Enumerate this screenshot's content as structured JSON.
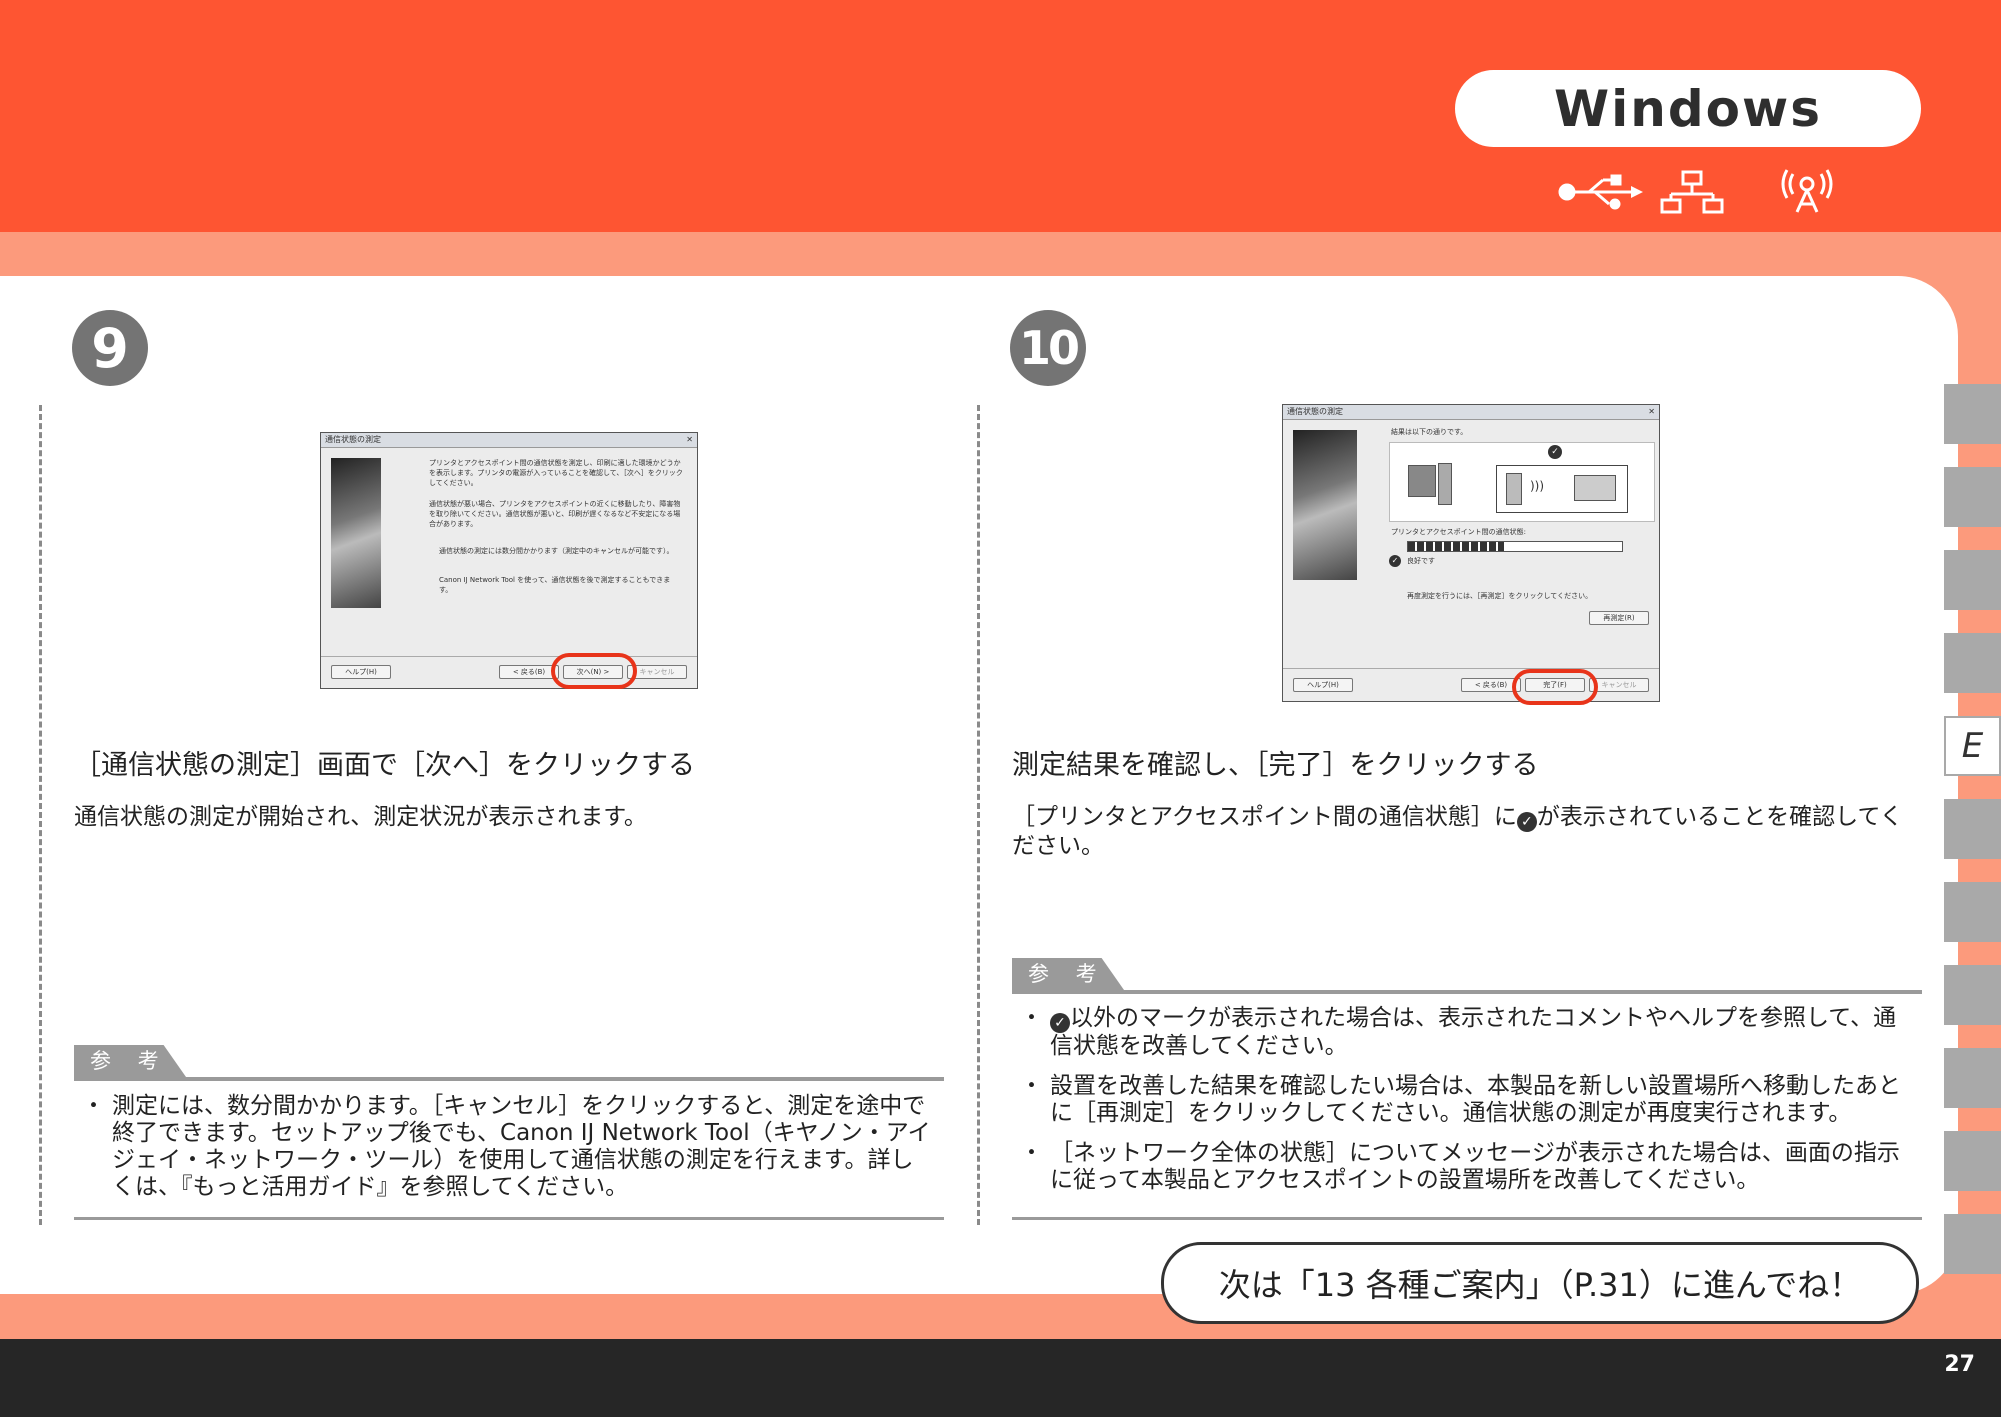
{
  "header": {
    "os_label": "Windows",
    "connection_icons": [
      "usb-icon",
      "wired-lan-icon",
      "wireless-lan-icon"
    ]
  },
  "side_tab": {
    "label": "E"
  },
  "step9": {
    "number": "9",
    "heading": "［通信状態の測定］画面で［次へ］をクリックする",
    "body": "通信状態の測定が開始され、測定状況が表示されます。",
    "note_label": "参 考",
    "notes": [
      "測定には、数分間かかります。［キャンセル］をクリックすると、測定を途中で終了できます。セットアップ後でも、Canon IJ Network Tool（キヤノン・アイジェイ・ネットワーク・ツール）を使用して通信状態の測定を行えます。詳しくは、『もっと活用ガイド』を参照してください。"
    ],
    "screenshot": {
      "title": "通信状態の測定",
      "text1": "プリンタとアクセスポイント間の通信状態を測定し、印刷に適した環境かどうかを表示します。プリンタの電源が入っていることを確認して、［次へ］をクリックしてください。",
      "text2": "通信状態が悪い場合、プリンタをアクセスポイントの近くに移動したり、障害物を取り除いてください。通信状態が悪いと、印刷が遅くなるなど不安定になる場合があります。",
      "bullet1": "通信状態の測定には数分間かかります（測定中のキャンセルが可能です）。",
      "bullet2": "Canon IJ Network Tool を使って、通信状態を後で測定することもできます。",
      "help_button": "ヘルプ(H)",
      "back_button": "< 戻る(B)",
      "next_button": "次へ(N) >",
      "cancel_button": "キャンセル"
    }
  },
  "step10": {
    "number": "10",
    "heading": "測定結果を確認し、［完了］をクリックする",
    "body_before_check": "［プリンタとアクセスポイント間の通信状態］に",
    "body_after_check": "が表示されていることを確認してください。",
    "note_label": "参 考",
    "notes": [
      {
        "before": "",
        "check": true,
        "after": "以外のマークが表示された場合は、表示されたコメントやヘルプを参照して、通信状態を改善してください。"
      },
      {
        "before": "設置を改善した結果を確認したい場合は、本製品を新しい設置場所へ移動したあとに［再測定］をクリックしてください。通信状態の測定が再度実行されます。",
        "check": false,
        "after": ""
      },
      {
        "before": "［ネットワーク全体の状態］についてメッセージが表示された場合は、画面の指示に従って本製品とアクセスポイントの設置場所を改善してください。",
        "check": false,
        "after": ""
      }
    ],
    "screenshot": {
      "title": "通信状態の測定",
      "result_text": "結果は以下の通りです。",
      "status_label": "プリンタとアクセスポイント間の通信状態:",
      "status_value": "良好です",
      "remeasure_text": "再度測定を行うには、［再測定］をクリックしてください。",
      "remeasure_button": "再測定(R)",
      "help_button": "ヘルプ(H)",
      "back_button": "< 戻る(B)",
      "finish_button": "完了(F)",
      "cancel_button": "キャンセル",
      "signal_level": 0.45
    }
  },
  "next_message": "次は「13 各種ご案内」（P.31）に進んでね！",
  "page_number": "27"
}
